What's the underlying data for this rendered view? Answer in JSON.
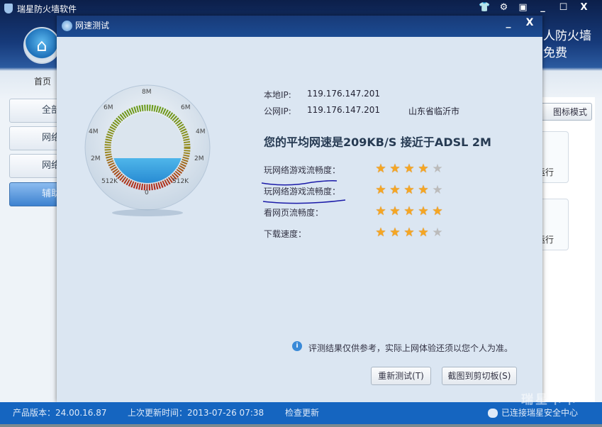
{
  "app": {
    "title": "瑞星防火墙软件",
    "banner_line1": "人防火墙",
    "banner_line2": "免费",
    "home_label": "首页"
  },
  "window_controls": [
    "skin",
    "settings",
    "menu",
    "minimize",
    "maximize",
    "close"
  ],
  "sidebar": {
    "items": [
      {
        "label": "全部"
      },
      {
        "label": "网络"
      },
      {
        "label": "网络"
      },
      {
        "label": "辅助",
        "active": true
      }
    ]
  },
  "right_panel": {
    "view_mode_label": "图标模式",
    "card_labels": [
      "运行",
      "运行"
    ]
  },
  "dialog": {
    "title": "网速测试",
    "local_ip_label": "本地IP:",
    "local_ip": "119.176.147.201",
    "public_ip_label": "公网IP:",
    "public_ip": "119.176.147.201",
    "location": "山东省临沂市",
    "headline": "您的平均网速是209KB/S 接近于ADSL 2M",
    "ratings": [
      {
        "label": "玩网络游戏流畅度：",
        "stars": 4,
        "max": 5
      },
      {
        "label": "玩网络游戏流畅度：",
        "stars": 4,
        "max": 5
      },
      {
        "label": "看网页流畅度：",
        "stars": 5,
        "max": 5
      },
      {
        "label": "下载速度：",
        "stars": 4,
        "max": 5
      }
    ],
    "gauge": {
      "labels": {
        "top": "8M",
        "l6": "6M",
        "r6": "6M",
        "l4": "4M",
        "r4": "4M",
        "l2": "2M",
        "r2": "2M",
        "l512": "512K",
        "r512": "512K",
        "bottom": "0"
      },
      "fill_percent": 35
    },
    "note": "评测结果仅供参考，实际上网体验还须以您个人为准。",
    "retest_button": "重新测试(T)",
    "copy_button": "截图到剪切板(S)"
  },
  "status": {
    "version": "产品版本：24.00.16.87",
    "last_update": "上次更新时间：2013-07-26 07:38",
    "check_update": "检查更新",
    "connection": "已连接瑞星安全中心",
    "watermark": "瑞星卡卡"
  },
  "colors": {
    "status_bar": "#1565c0",
    "title_bar": "#183a78",
    "star": "#f5a623"
  }
}
